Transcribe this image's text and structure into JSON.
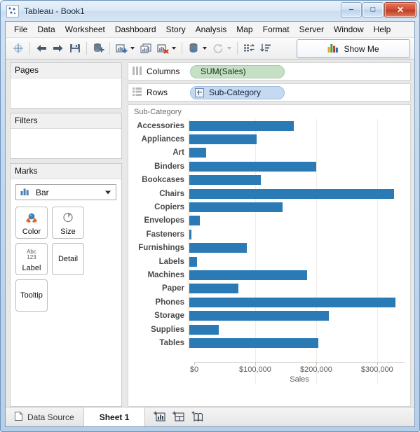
{
  "window": {
    "title": "Tableau - Book1",
    "app_icon": "tableau-logo-icon",
    "buttons": {
      "minimize": "–",
      "maximize": "□",
      "close": "✕"
    }
  },
  "menubar": {
    "items": [
      {
        "label": "File"
      },
      {
        "label": "Data"
      },
      {
        "label": "Worksheet"
      },
      {
        "label": "Dashboard"
      },
      {
        "label": "Story"
      },
      {
        "label": "Analysis"
      },
      {
        "label": "Map"
      },
      {
        "label": "Format"
      },
      {
        "label": "Server"
      },
      {
        "label": "Window"
      },
      {
        "label": "Help"
      }
    ]
  },
  "toolbar": {
    "icons": [
      "tableau-start-icon",
      "back-arrow-icon",
      "forward-arrow-icon",
      "save-icon",
      "new-data-source-icon",
      "new-worksheet-icon",
      "duplicate-sheet-icon",
      "clear-sheet-icon",
      "data-pane-icon",
      "refresh-icon",
      "swap-rows-columns-icon",
      "sort-descending-icon"
    ],
    "show_me_label": "Show Me",
    "show_me_icon": "show-me-bars-icon"
  },
  "left_pane": {
    "pages": {
      "title": "Pages"
    },
    "filters": {
      "title": "Filters"
    },
    "marks": {
      "title": "Marks",
      "mark_type": "Bar",
      "mark_type_icon": "bar-mark-icon",
      "buttons": [
        {
          "label": "Color",
          "icon": "color-palette-icon"
        },
        {
          "label": "Size",
          "icon": "size-circle-icon"
        },
        {
          "label": "Label",
          "icon": "abc123-label-icon"
        },
        {
          "label": "Detail",
          "icon": ""
        },
        {
          "label": "Tooltip",
          "icon": ""
        }
      ]
    }
  },
  "shelves": {
    "columns": {
      "label": "Columns",
      "icon": "columns-shelf-icon",
      "pill": "SUM(Sales)"
    },
    "rows": {
      "label": "Rows",
      "icon": "rows-shelf-icon",
      "pill": "Sub-Category",
      "expand_icon": "expand-plus-icon"
    }
  },
  "viz": {
    "field_header": "Sub-Category"
  },
  "tabbar": {
    "data_source": {
      "label": "Data Source",
      "icon": "data-source-icon"
    },
    "sheets": [
      {
        "label": "Sheet 1",
        "active": true
      }
    ],
    "new_sheet_icon": "new-worksheet-tab-icon",
    "new_dashboard_icon": "new-dashboard-tab-icon",
    "new_story_icon": "new-story-tab-icon"
  },
  "colors": {
    "bar": "#2a7ab5",
    "columns_pill": "#c5e0c5",
    "rows_pill": "#c5d9f1",
    "window_frame": "#b6cfe8",
    "close_button": "#cf4e32"
  },
  "chart_data": {
    "type": "bar",
    "orientation": "horizontal",
    "title": "",
    "xlabel": "Sales",
    "ylabel": "Sub-Category",
    "xlim": [
      0,
      345000
    ],
    "xticks": [
      0,
      100000,
      200000,
      300000
    ],
    "xtick_labels": [
      "$0",
      "$100,000",
      "$200,000",
      "$300,000"
    ],
    "grid": true,
    "legend": "none",
    "categories": [
      "Accessories",
      "Appliances",
      "Art",
      "Binders",
      "Bookcases",
      "Chairs",
      "Copiers",
      "Envelopes",
      "Fasteners",
      "Furnishings",
      "Labels",
      "Machines",
      "Paper",
      "Phones",
      "Storage",
      "Supplies",
      "Tables"
    ],
    "values": [
      167380,
      107532,
      27119,
      203413,
      114880,
      328449,
      149528,
      16476,
      3024,
      91705,
      12486,
      189239,
      78479,
      330007,
      223844,
      46674,
      206966
    ]
  }
}
